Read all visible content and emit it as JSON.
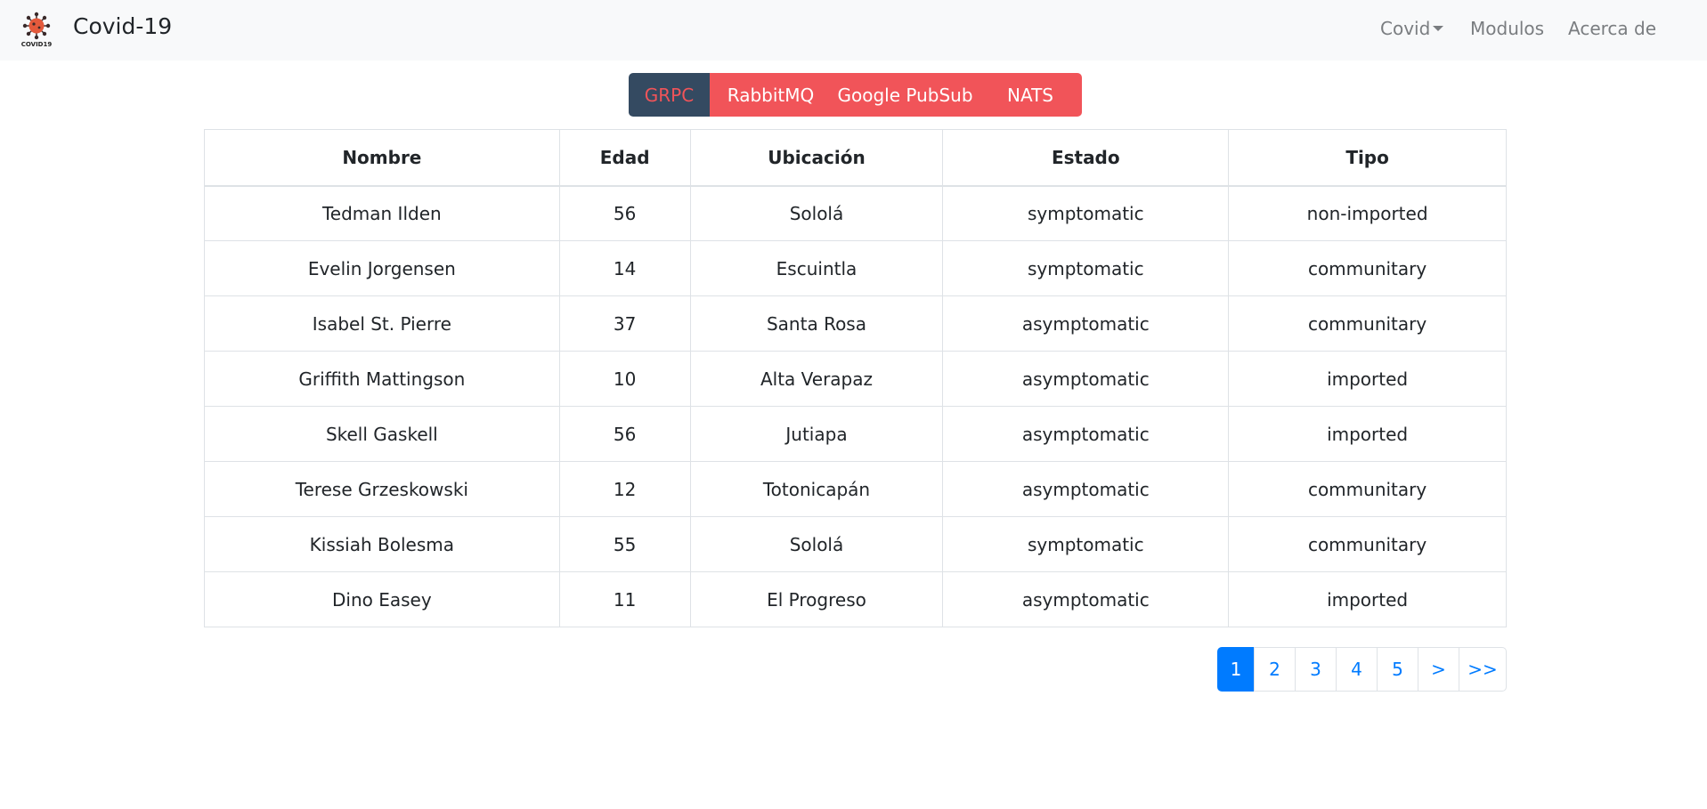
{
  "navbar": {
    "brand_logo_text": "COVID19",
    "brand": "Covid-19",
    "links": [
      {
        "label": "Covid",
        "has_dropdown": true
      },
      {
        "label": "Modulos"
      },
      {
        "label": "Acerca de"
      }
    ]
  },
  "sources": {
    "active": "GRPC",
    "items": [
      "GRPC",
      "RabbitMQ",
      "Google PubSub",
      "NATS"
    ]
  },
  "table": {
    "headers": [
      "Nombre",
      "Edad",
      "Ubicación",
      "Estado",
      "Tipo"
    ],
    "rows": [
      [
        "Tedman Ilden",
        "56",
        "Sololá",
        "symptomatic",
        "non-imported"
      ],
      [
        "Evelin Jorgensen",
        "14",
        "Escuintla",
        "symptomatic",
        "communitary"
      ],
      [
        "Isabel St. Pierre",
        "37",
        "Santa Rosa",
        "asymptomatic",
        "communitary"
      ],
      [
        "Griffith Mattingson",
        "10",
        "Alta Verapaz",
        "asymptomatic",
        "imported"
      ],
      [
        "Skell Gaskell",
        "56",
        "Jutiapa",
        "asymptomatic",
        "imported"
      ],
      [
        "Terese Grzeskowski",
        "12",
        "Totonicapán",
        "asymptomatic",
        "communitary"
      ],
      [
        "Kissiah Bolesma",
        "55",
        "Sololá",
        "symptomatic",
        "communitary"
      ],
      [
        "Dino Easey",
        "11",
        "El Progreso",
        "asymptomatic",
        "imported"
      ]
    ]
  },
  "pagination": {
    "current": "1",
    "pages": [
      "1",
      "2",
      "3",
      "4",
      "5"
    ],
    "next": ">",
    "last": ">>"
  },
  "colors": {
    "navbar_bg": "#f8f9fa",
    "source_btn": "#f15459",
    "source_active_bg": "#344a61",
    "page_active": "#007bff"
  }
}
